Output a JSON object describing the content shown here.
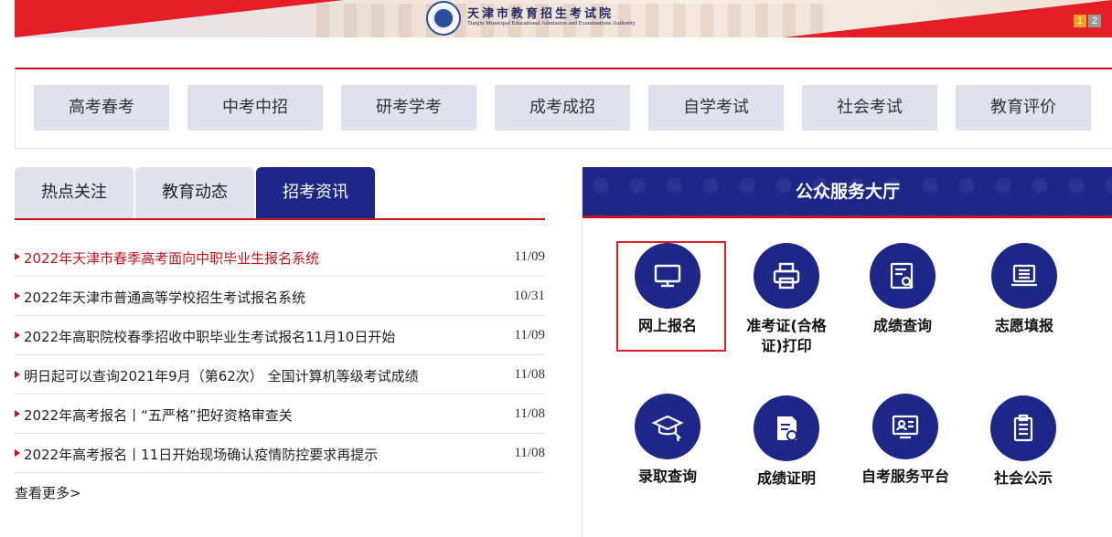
{
  "header": {
    "org_name_cn": "天津市教育招生考试院",
    "org_name_en": "Tianjin Municipal Educational Admission and Examinations Authority",
    "pager": [
      "1",
      "2"
    ]
  },
  "category_nav": [
    "高考春考",
    "中考中招",
    "研考学考",
    "成考成招",
    "自学考试",
    "社会考试",
    "教育评价"
  ],
  "news_tabs": [
    {
      "label": "热点关注",
      "active": false
    },
    {
      "label": "教育动态",
      "active": false
    },
    {
      "label": "招考资讯",
      "active": true
    }
  ],
  "news": [
    {
      "title": "2022年天津市春季高考面向中职毕业生报名系统",
      "date": "11/09",
      "hot": true
    },
    {
      "title": "2022年天津市普通高等学校招生考试报名系统",
      "date": "10/31",
      "hot": false
    },
    {
      "title": "2022年高职院校春季招收中职毕业生考试报名11月10日开始",
      "date": "11/09",
      "hot": false
    },
    {
      "title": "明日起可以查询2021年9月（第62次） 全国计算机等级考试成绩",
      "date": "11/08",
      "hot": false
    },
    {
      "title": "2022年高考报名丨“五严格”把好资格审查关",
      "date": "11/08",
      "hot": false
    },
    {
      "title": "2022年高考报名丨11日开始现场确认疫情防控要求再提示",
      "date": "11/08",
      "hot": false
    }
  ],
  "more_label": "查看更多>",
  "service_hall": {
    "title": "公众服务大厅",
    "services": [
      {
        "label": "网上报名",
        "icon": "monitor-icon"
      },
      {
        "label": "准考证(合格证)打印",
        "icon": "printer-icon"
      },
      {
        "label": "成绩查询",
        "icon": "score-search-icon"
      },
      {
        "label": "志愿填报",
        "icon": "laptop-list-icon"
      },
      {
        "label": "录取查询",
        "icon": "graduation-cap-icon"
      },
      {
        "label": "成绩证明",
        "icon": "certificate-icon"
      },
      {
        "label": "自考服务平台",
        "icon": "screen-user-icon"
      },
      {
        "label": "社会公示",
        "icon": "clipboard-icon"
      }
    ]
  },
  "colors": {
    "navy": "#1d2787",
    "red": "#c4151c",
    "nav_bg": "#dfe2ed"
  }
}
